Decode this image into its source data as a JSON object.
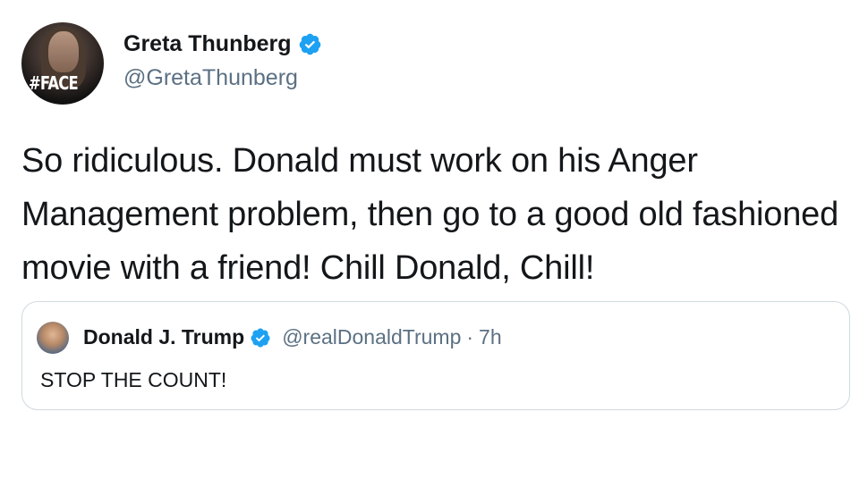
{
  "tweet": {
    "author": {
      "name": "Greta Thunberg",
      "handle": "@GretaThunberg",
      "verified": true,
      "avatar_overlay_text": "#FACE"
    },
    "text": "So ridiculous. Donald must work on his Anger Management problem, then go to a good old fashioned movie with a friend! Chill Donald, Chill!"
  },
  "quoted_tweet": {
    "author": {
      "name": "Donald J. Trump",
      "handle": "@realDonaldTrump",
      "verified": true
    },
    "separator": "·",
    "time": "7h",
    "text": "STOP THE COUNT!"
  },
  "colors": {
    "verified_blue": "#1da1f2",
    "secondary_text": "#5b7083",
    "border": "#cfd9de"
  },
  "icons": [
    "verified-badge-icon"
  ]
}
